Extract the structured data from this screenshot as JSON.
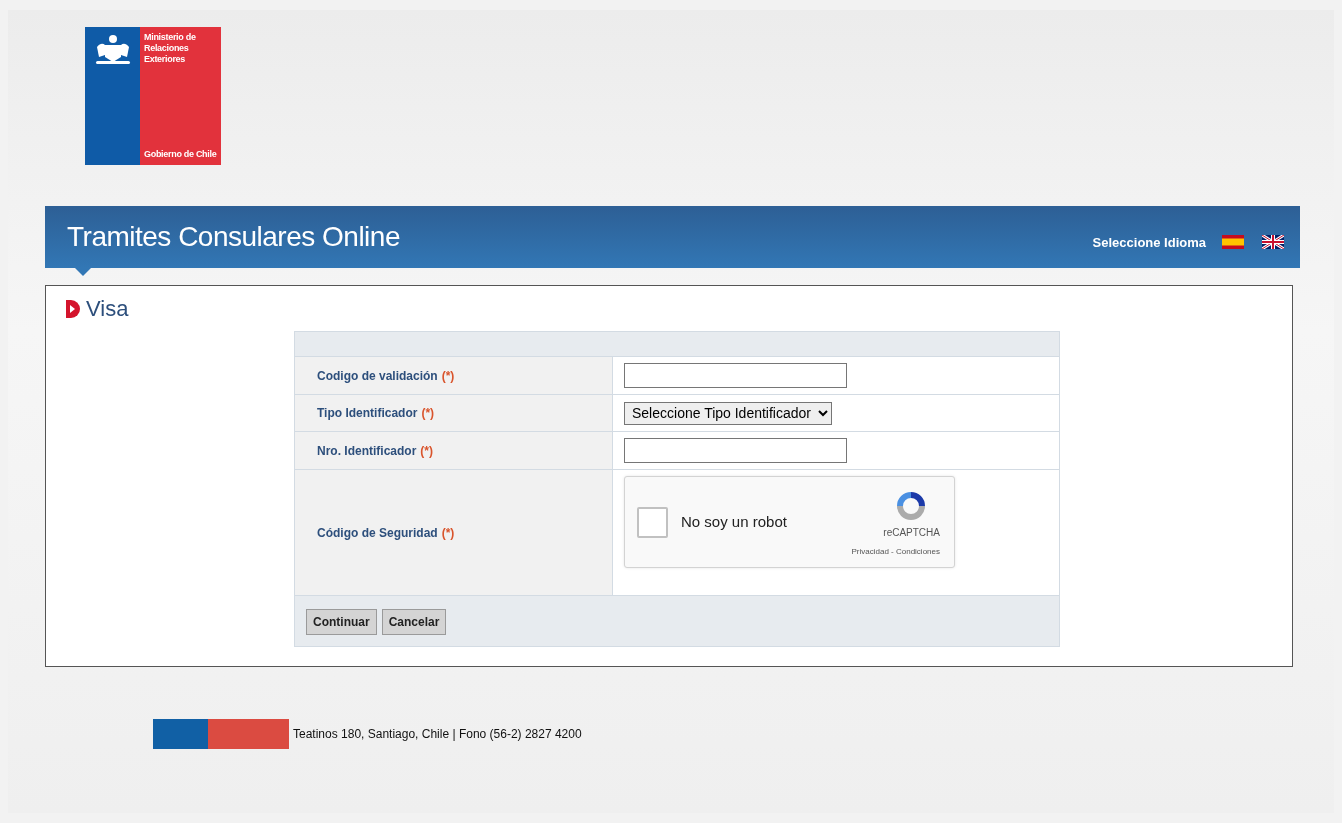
{
  "logo": {
    "lines": [
      "Ministerio de",
      "Relaciones",
      "Exteriores"
    ],
    "footer": "Gobierno de Chile"
  },
  "header": {
    "title": "Tramites Consulares Online",
    "language_label": "Seleccione Idioma"
  },
  "section": {
    "title": "Visa"
  },
  "form": {
    "rows": [
      {
        "kind": "text",
        "label": "Codigo de validación",
        "required_mark": "(*)"
      },
      {
        "kind": "select",
        "label": "Tipo Identificador",
        "required_mark": "(*)",
        "value": "Seleccione Tipo Identificador"
      },
      {
        "kind": "text",
        "label": "Nro. Identificador",
        "required_mark": "(*)"
      },
      {
        "kind": "captcha",
        "label": "Código de Seguridad",
        "required_mark": "(*)",
        "captcha": {
          "label": "No soy un robot",
          "checked": false,
          "brand": "reCAPTCHA",
          "links": "Privacidad - Condiciones"
        }
      }
    ],
    "buttons": [
      "Continuar",
      "Cancelar"
    ]
  },
  "footer": {
    "address": "Teatinos 180, Santiago, Chile | Fono (56-2) 2827 4200"
  }
}
